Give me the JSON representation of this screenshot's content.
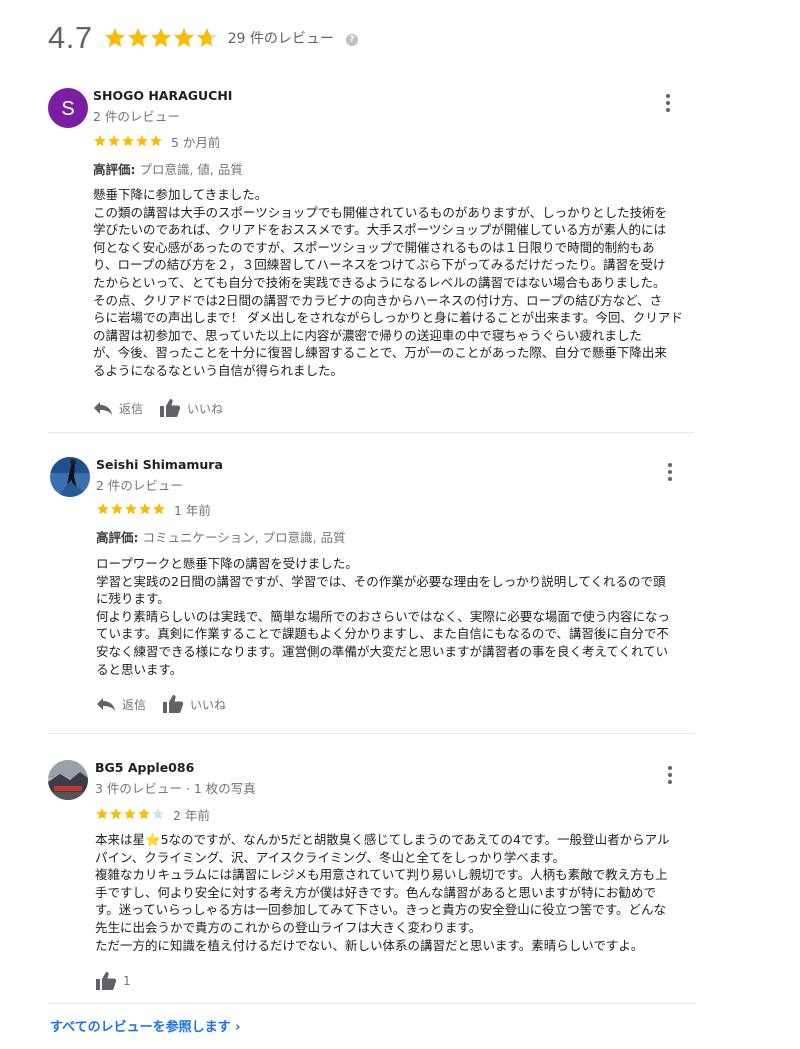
{
  "summary": {
    "rating": "4.7",
    "stars": 4.7,
    "review_count": "29 件のレビュー"
  },
  "colors": {
    "star": "#fbbc04",
    "star_empty": "#dadce0",
    "link": "#1a73e8"
  },
  "actions": {
    "reply": "返信",
    "like": "いいね"
  },
  "reviews": [
    {
      "name": "SHOGO HARAGUCHI",
      "avatar_letter": "S",
      "avatar_color": "#7b1fa2",
      "meta": "2 件のレビュー",
      "rating": 5,
      "date": "5 か月前",
      "highlights_label": "高評価:",
      "highlights": "プロ意識, 値, 品質",
      "text": "懸垂下降に参加してきました。\nこの類の講習は大手のスポーツショップでも開催されているものがありますが、しっかりとした技術を\n学びたいのであれば、クリアドをおススメです。大手スポーツショップが開催している方が素人的には\n何となく安心感があったのですが、スポーツショップで開催されるものは１日限りで時間的制約もあ\nり、ロープの結び方を２，３回練習してハーネスをつけてぶら下がってみるだけだったり。講習を受け\nたからといって、とても自分で技術を実践できるようになるレベルの講習ではない場合もありました。\nその点、クリアドでは2日間の講習でカラビナの向きからハーネスの付け方、ロープの結び方など、さ\nらに岩場での声出しまで！ ダメ出しをされながらしっかりと身に着けることが出来ます。今回、クリアド\nの講習は初参加で、思っていた以上に内容が濃密で帰りの送迎車の中で寝ちゃうぐらい疲れました\nが、今後、習ったことを十分に復習し練習することで、万が一のことがあった際、自分で懸垂下降出来\nるようになるなという自信が得られました。"
    },
    {
      "name": "Seishi Shimamura",
      "meta": "2 件のレビュー",
      "rating": 5,
      "date": "1 年前",
      "highlights_label": "高評価:",
      "highlights": "コミュニケーション, プロ意識, 品質",
      "text": "ロープワークと懸垂下降の講習を受けました。\n学習と実践の2日間の講習ですが、学習では、その作業が必要な理由をしっかり説明してくれるので頭\nに残ります。\n何より素晴らしいのは実践で、簡単な場所でのおさらいではなく、実際に必要な場面で使う内容になっ\nています。真剣に作業することで課題もよく分かりますし、また自信にもなるので、講習後に自分で不\n安なく練習できる様になります。運営側の準備が大変だと思いますが講習者の事を良く考えてくれてい\nると思います。"
    },
    {
      "name": "BG5 Apple086",
      "meta": "3 件のレビュー · 1 枚の写真",
      "rating": 4,
      "date": "2 年前",
      "text": "本来は星⭐5なのですが、なんか5だと胡散臭く感じてしまうのであえての4です。一般登山者からアル\nパイン、クライミング、沢、アイスクライミング、冬山と全てをしっかり学べます。\n複雑なカリキュラムには講習にレジメも用意されていて判り易いし親切です。人柄も素敵で教え方も上\n手ですし、何より安全に対する考え方が僕は好きです。色んな講習があると思いますが特にお勧めで\nす。迷っていらっしゃる方は一回参加してみて下さい。きっと貴方の安全登山に役立つ筈です。どんな\n先生に出会うかで貴方のこれからの登山ライフは大きく変わります。\nただ一方的に知識を植え付けるだけでない、新しい体系の講習だと思います。素晴らしいですよ。",
      "likes": "1"
    }
  ],
  "see_all": "すべてのレビューを参照します ›"
}
